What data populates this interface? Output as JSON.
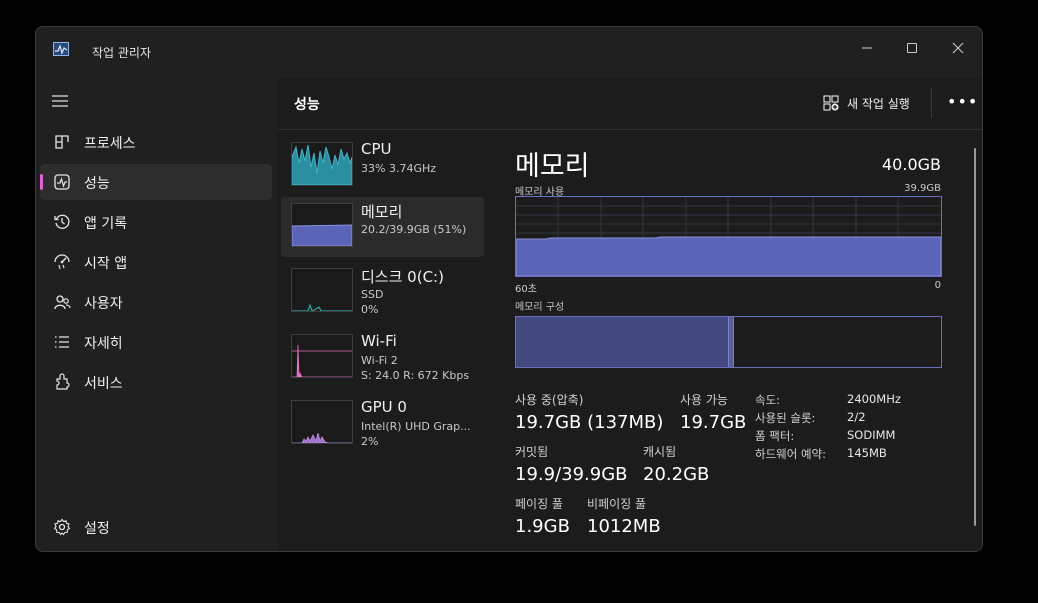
{
  "window": {
    "title": "작업 관리자"
  },
  "sidebar": {
    "items": [
      {
        "label": "프로세스",
        "icon": "processes-icon"
      },
      {
        "label": "성능",
        "icon": "performance-icon",
        "active": true
      },
      {
        "label": "앱 기록",
        "icon": "app-history-icon"
      },
      {
        "label": "시작 앱",
        "icon": "startup-apps-icon"
      },
      {
        "label": "사용자",
        "icon": "users-icon"
      },
      {
        "label": "자세히",
        "icon": "details-icon"
      },
      {
        "label": "서비스",
        "icon": "services-icon"
      }
    ],
    "settings_label": "설정"
  },
  "header": {
    "title": "성능",
    "new_task_label": "새 작업 실행"
  },
  "perf_list": [
    {
      "name": "CPU",
      "s1": "33% 3.74GHz",
      "s2": ""
    },
    {
      "name": "메모리",
      "s1": "20.2/39.9GB (51%)",
      "s2": "",
      "active": true
    },
    {
      "name": "디스크 0(C:)",
      "s1": "SSD",
      "s2": "0%"
    },
    {
      "name": "Wi-Fi",
      "s1": "Wi-Fi 2",
      "s2": "S: 24.0  R: 672 Kbps"
    },
    {
      "name": "GPU 0",
      "s1": "Intel(R) UHD Grap...",
      "s2": "2%"
    }
  ],
  "detail": {
    "title": "메모리",
    "total": "40.0GB",
    "usage_label": "메모리 사용",
    "usage_max": "39.9GB",
    "graph_left": "60초",
    "graph_right": "0",
    "composition_label": "메모리 구성",
    "in_use_label": "사용 중(압축)",
    "in_use_value": "19.7GB (137MB)",
    "available_label": "사용 가능",
    "available_value": "19.7GB",
    "committed_label": "커밋됨",
    "committed_value": "19.9/39.9GB",
    "cached_label": "캐시됨",
    "cached_value": "20.2GB",
    "paged_label": "페이징 풀",
    "paged_value": "1.9GB",
    "nonpaged_label": "비페이징 풀",
    "nonpaged_value": "1012MB",
    "speed_label": "속도:",
    "speed_value": "2400MHz",
    "slots_label": "사용된 슬롯:",
    "slots_value": "2/2",
    "form_label": "폼 팩터:",
    "form_value": "SODIMM",
    "hw_label": "하드웨어 예약:",
    "hw_value": "145MB",
    "usage_fraction": 0.51
  },
  "colors": {
    "memory": "#5c64b8",
    "memory_line": "#8c90e0",
    "cpu": "#3cb4c8",
    "wifi": "#e070c0",
    "gpu": "#a070c8",
    "disk": "#2aa6a0",
    "active_indicator": "#e060d8"
  }
}
